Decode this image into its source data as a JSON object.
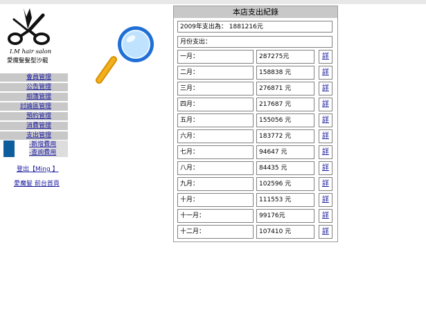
{
  "logo": {
    "name": "I.M hair salon",
    "subtitle": "愛魔髮髮型沙龍"
  },
  "menu": [
    {
      "label": "會員管理"
    },
    {
      "label": "公告管理"
    },
    {
      "label": "相簿管理"
    },
    {
      "label": "討論區管理"
    },
    {
      "label": "預約管理"
    },
    {
      "label": "消費管理"
    },
    {
      "label": "支出管理"
    }
  ],
  "submenu": [
    {
      "label": "-新增費用"
    },
    {
      "label": "-查詢費用"
    }
  ],
  "logout": "登出【Ming 】",
  "frontpage": "愛魔髮 前台首頁",
  "panel": {
    "title": "本店支出紀錄",
    "year_total": "2009年支出為： 1881216元",
    "monthly_label": "月份支出：",
    "detail_label": "詳",
    "months": [
      {
        "month": "一月：",
        "amount": "287275元"
      },
      {
        "month": "二月：",
        "amount": "158838 元"
      },
      {
        "month": "三月：",
        "amount": "276871 元"
      },
      {
        "month": "四月：",
        "amount": "217687 元"
      },
      {
        "month": "五月：",
        "amount": "155056 元"
      },
      {
        "month": "六月：",
        "amount": "183772 元"
      },
      {
        "month": "七月：",
        "amount": "94647 元"
      },
      {
        "month": "八月：",
        "amount": "84435 元"
      },
      {
        "month": "九月：",
        "amount": "102596 元"
      },
      {
        "month": "十月：",
        "amount": "111553 元"
      },
      {
        "month": "十一月：",
        "amount": "99176元"
      },
      {
        "month": "十二月：",
        "amount": "107410 元"
      }
    ]
  },
  "colors": {
    "link": "#1a1aa0",
    "menu_bg": "#c8c8c8",
    "sub_square": "#0d5e9c",
    "magnifier_rim": "#1f6fd6",
    "magnifier_handle": "#f2b01e"
  },
  "icons": {
    "logo": "scissors-comb-icon",
    "magnifier": "magnifier-icon"
  }
}
